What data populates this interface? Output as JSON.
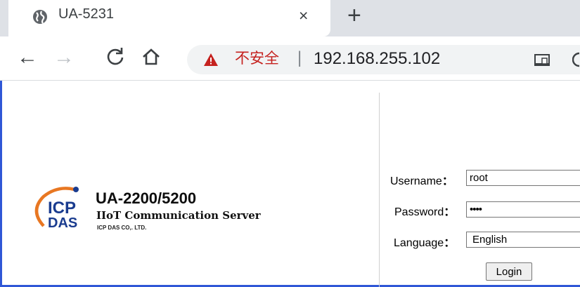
{
  "browser": {
    "tab": {
      "title": "UA-5231",
      "close": "×"
    },
    "new_tab": "+",
    "nav": {
      "back": "←",
      "forward": "→"
    },
    "address": {
      "security_label": "不安全",
      "separator": "|",
      "url": "192.168.255.102"
    }
  },
  "colors": {
    "frame": "#2f57d6",
    "not_secure": "#c5221f",
    "logo_orange": "#e87722",
    "logo_blue": "#1a3c8f"
  },
  "page": {
    "logo": {
      "icp": "ICP",
      "das": "DAS"
    },
    "product_name": "UA-2200/5200",
    "product_subtitle": "IIoT Communication Server",
    "company": "ICP DAS CO,. LTD.",
    "form": {
      "username_label": "Username",
      "username_value": "root",
      "password_label": "Password",
      "password_value": "••••",
      "language_label": "Language",
      "language_value": "English",
      "colon": "：",
      "login_label": "Login"
    }
  }
}
